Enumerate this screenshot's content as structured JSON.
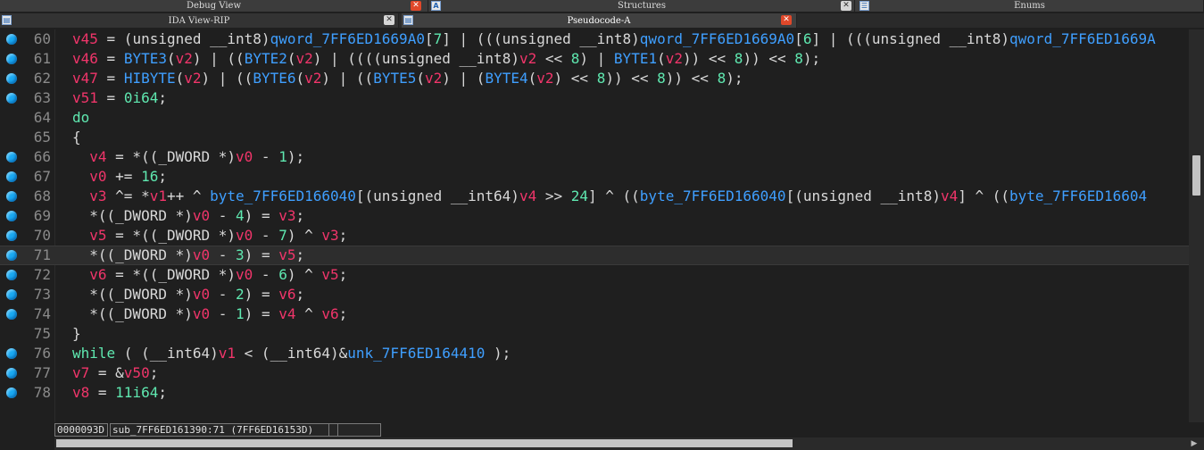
{
  "tabs_top": [
    {
      "label": "Debug View",
      "close": "✕"
    },
    {
      "label": "Structures",
      "close": "✕",
      "icon": "A"
    },
    {
      "label": "Enums",
      "icon": "☰"
    }
  ],
  "tabs_second": [
    {
      "label": "IDA View-RIP",
      "close": "✕",
      "icon": "▤"
    },
    {
      "label": "Pseudocode-A",
      "close": "✕",
      "icon": "▤"
    }
  ],
  "code_lines": [
    {
      "num": "60",
      "dot": true
    },
    {
      "num": "61",
      "dot": true
    },
    {
      "num": "62",
      "dot": true
    },
    {
      "num": "63",
      "dot": true
    },
    {
      "num": "64",
      "dot": false
    },
    {
      "num": "65",
      "dot": false
    },
    {
      "num": "66",
      "dot": true
    },
    {
      "num": "67",
      "dot": true
    },
    {
      "num": "68",
      "dot": true
    },
    {
      "num": "69",
      "dot": true
    },
    {
      "num": "70",
      "dot": true
    },
    {
      "num": "71",
      "dot": true
    },
    {
      "num": "72",
      "dot": true
    },
    {
      "num": "73",
      "dot": true
    },
    {
      "num": "74",
      "dot": true
    },
    {
      "num": "75",
      "dot": false
    },
    {
      "num": "76",
      "dot": true
    },
    {
      "num": "77",
      "dot": true
    },
    {
      "num": "78",
      "dot": true
    }
  ],
  "code_tokens": [
    [
      [
        "v",
        "v45"
      ],
      [
        "p",
        " = (unsigned __int8)"
      ],
      [
        "f",
        "qword_7FF6ED1669A0"
      ],
      [
        "p",
        "["
      ],
      [
        "n",
        "7"
      ],
      [
        "p",
        "] | (((unsigned __int8)"
      ],
      [
        "f",
        "qword_7FF6ED1669A0"
      ],
      [
        "p",
        "["
      ],
      [
        "n",
        "6"
      ],
      [
        "p",
        "] | (((unsigned __int8)"
      ],
      [
        "f",
        "qword_7FF6ED1669A"
      ]
    ],
    [
      [
        "v",
        "v46"
      ],
      [
        "p",
        " = "
      ],
      [
        "f",
        "BYTE3"
      ],
      [
        "p",
        "("
      ],
      [
        "v",
        "v2"
      ],
      [
        "p",
        ") | (("
      ],
      [
        "f",
        "BYTE2"
      ],
      [
        "p",
        "("
      ],
      [
        "v",
        "v2"
      ],
      [
        "p",
        ") | ((((unsigned __int8)"
      ],
      [
        "v",
        "v2"
      ],
      [
        "p",
        " << "
      ],
      [
        "n",
        "8"
      ],
      [
        "p",
        ") | "
      ],
      [
        "f",
        "BYTE1"
      ],
      [
        "p",
        "("
      ],
      [
        "v",
        "v2"
      ],
      [
        "p",
        ")) << "
      ],
      [
        "n",
        "8"
      ],
      [
        "p",
        ")) << "
      ],
      [
        "n",
        "8"
      ],
      [
        "p",
        ");"
      ]
    ],
    [
      [
        "v",
        "v47"
      ],
      [
        "p",
        " = "
      ],
      [
        "f",
        "HIBYTE"
      ],
      [
        "p",
        "("
      ],
      [
        "v",
        "v2"
      ],
      [
        "p",
        ") | (("
      ],
      [
        "f",
        "BYTE6"
      ],
      [
        "p",
        "("
      ],
      [
        "v",
        "v2"
      ],
      [
        "p",
        ") | (("
      ],
      [
        "f",
        "BYTE5"
      ],
      [
        "p",
        "("
      ],
      [
        "v",
        "v2"
      ],
      [
        "p",
        ") | ("
      ],
      [
        "f",
        "BYTE4"
      ],
      [
        "p",
        "("
      ],
      [
        "v",
        "v2"
      ],
      [
        "p",
        ") << "
      ],
      [
        "n",
        "8"
      ],
      [
        "p",
        ")) << "
      ],
      [
        "n",
        "8"
      ],
      [
        "p",
        ")) << "
      ],
      [
        "n",
        "8"
      ],
      [
        "p",
        ");"
      ]
    ],
    [
      [
        "v",
        "v51"
      ],
      [
        "p",
        " = "
      ],
      [
        "n",
        "0i64"
      ],
      [
        "p",
        ";"
      ]
    ],
    [
      [
        "k",
        "do"
      ]
    ],
    [
      [
        "p",
        "{"
      ]
    ],
    [
      [
        "p",
        "  "
      ],
      [
        "v",
        "v4"
      ],
      [
        "p",
        " = *((_DWORD *)"
      ],
      [
        "v",
        "v0"
      ],
      [
        "p",
        " - "
      ],
      [
        "n",
        "1"
      ],
      [
        "p",
        ");"
      ]
    ],
    [
      [
        "p",
        "  "
      ],
      [
        "v",
        "v0"
      ],
      [
        "p",
        " += "
      ],
      [
        "n",
        "16"
      ],
      [
        "p",
        ";"
      ]
    ],
    [
      [
        "p",
        "  "
      ],
      [
        "v",
        "v3"
      ],
      [
        "p",
        " ^= *"
      ],
      [
        "v",
        "v1"
      ],
      [
        "p",
        "++ ^ "
      ],
      [
        "f",
        "byte_7FF6ED166040"
      ],
      [
        "p",
        "[(unsigned __int64)"
      ],
      [
        "v",
        "v4"
      ],
      [
        "p",
        " >> "
      ],
      [
        "n",
        "24"
      ],
      [
        "p",
        "] ^ (("
      ],
      [
        "f",
        "byte_7FF6ED166040"
      ],
      [
        "p",
        "[(unsigned __int8)"
      ],
      [
        "v",
        "v4"
      ],
      [
        "p",
        "] ^ (("
      ],
      [
        "f",
        "byte_7FF6ED16604"
      ]
    ],
    [
      [
        "p",
        "  *((_DWORD *)"
      ],
      [
        "v",
        "v0"
      ],
      [
        "p",
        " - "
      ],
      [
        "n",
        "4"
      ],
      [
        "p",
        ") = "
      ],
      [
        "v",
        "v3"
      ],
      [
        "p",
        ";"
      ]
    ],
    [
      [
        "p",
        "  "
      ],
      [
        "v",
        "v5"
      ],
      [
        "p",
        " = *((_DWORD *)"
      ],
      [
        "v",
        "v0"
      ],
      [
        "p",
        " - "
      ],
      [
        "n",
        "7"
      ],
      [
        "p",
        ") ^ "
      ],
      [
        "v",
        "v3"
      ],
      [
        "p",
        ";"
      ]
    ],
    [
      [
        "p",
        "  *((_DWORD *)"
      ],
      [
        "v",
        "v0"
      ],
      [
        "p",
        " - "
      ],
      [
        "n",
        "3"
      ],
      [
        "p",
        ") = "
      ],
      [
        "v",
        "v5"
      ],
      [
        "p",
        ";"
      ]
    ],
    [
      [
        "p",
        "  "
      ],
      [
        "v",
        "v6"
      ],
      [
        "p",
        " = *((_DWORD *)"
      ],
      [
        "v",
        "v0"
      ],
      [
        "p",
        " - "
      ],
      [
        "n",
        "6"
      ],
      [
        "p",
        ") ^ "
      ],
      [
        "v",
        "v5"
      ],
      [
        "p",
        ";"
      ]
    ],
    [
      [
        "p",
        "  *((_DWORD *)"
      ],
      [
        "v",
        "v0"
      ],
      [
        "p",
        " - "
      ],
      [
        "n",
        "2"
      ],
      [
        "p",
        ") = "
      ],
      [
        "v",
        "v6"
      ],
      [
        "p",
        ";"
      ]
    ],
    [
      [
        "p",
        "  *((_DWORD *)"
      ],
      [
        "v",
        "v0"
      ],
      [
        "p",
        " - "
      ],
      [
        "n",
        "1"
      ],
      [
        "p",
        ") = "
      ],
      [
        "v",
        "v4"
      ],
      [
        "p",
        " ^ "
      ],
      [
        "v",
        "v6"
      ],
      [
        "p",
        ";"
      ]
    ],
    [
      [
        "p",
        "}"
      ]
    ],
    [
      [
        "k",
        "while"
      ],
      [
        "p",
        " ( (__int64)"
      ],
      [
        "v",
        "v1"
      ],
      [
        "p",
        " < (__int64)&"
      ],
      [
        "f",
        "unk_7FF6ED164410"
      ],
      [
        "p",
        " );"
      ]
    ],
    [
      [
        "v",
        "v7"
      ],
      [
        "p",
        " = &"
      ],
      [
        "v",
        "v50"
      ],
      [
        "p",
        ";"
      ]
    ],
    [
      [
        "v",
        "v8"
      ],
      [
        "p",
        " = "
      ],
      [
        "n",
        "11i64"
      ],
      [
        "p",
        ";"
      ]
    ]
  ],
  "cursor_line_index": 11,
  "status": {
    "offset": "0000093D",
    "location": "sub_7FF6ED161390:71 (7FF6ED16153D)",
    "empty": ""
  },
  "scroll_arrow": "▶",
  "colors": {
    "variable": "#f0356a",
    "function": "#3f9fff",
    "number": "#5fe8b0",
    "text": "#d8d8d8",
    "dot": "#19a9f2",
    "close_red": "#e0482a"
  }
}
